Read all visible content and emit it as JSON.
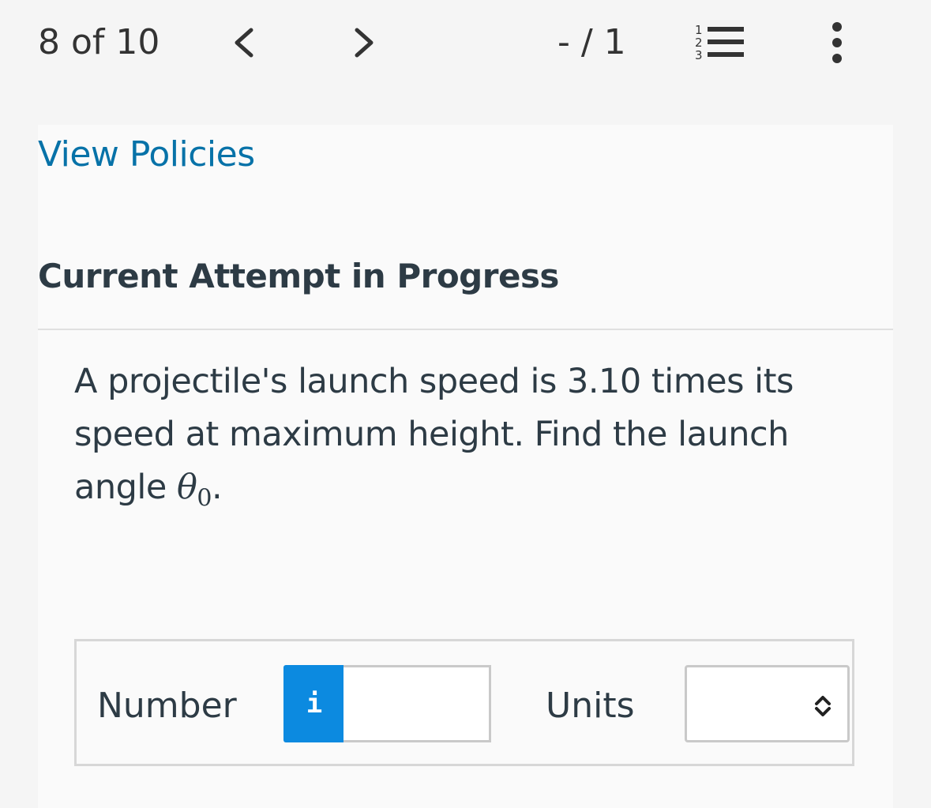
{
  "topbar": {
    "progress": "8 of 10",
    "prev_icon": "chevron-left-icon",
    "next_icon": "chevron-right-icon",
    "score": "- / 1",
    "list_icon": "numbered-list-icon",
    "list_icon_digits": [
      "1",
      "2",
      "3"
    ],
    "more_icon": "vertical-ellipsis-icon"
  },
  "content": {
    "policies_link": "View Policies",
    "attempt_heading": "Current Attempt in Progress",
    "question": {
      "text": "A projectile's launch speed is 3.10 times its speed at maximum height. Find the launch angle ",
      "symbol": "θ",
      "subscript": "0",
      "end": "."
    }
  },
  "answer": {
    "number_label": "Number",
    "info_icon_glyph": "i",
    "number_value": "",
    "units_label": "Units",
    "units_value": "",
    "select_icon": "up-down-chevron-icon"
  },
  "colors": {
    "link": "#0772a8",
    "info_button": "#0c8ae0",
    "text": "#2d3b45"
  }
}
